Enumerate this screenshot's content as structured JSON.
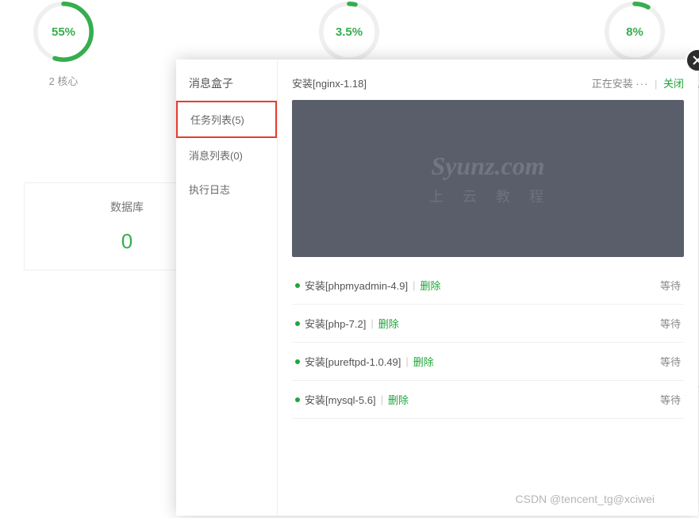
{
  "gauges": [
    {
      "value": "55%",
      "label": "2 核心",
      "dash": "165 300"
    },
    {
      "value": "3.5%",
      "label": "",
      "dash": "10 300"
    },
    {
      "value": "8%",
      "label": "",
      "dash": "24 300"
    }
  ],
  "bg_card": {
    "title": "数据库",
    "value": "0"
  },
  "right_frag1": "G /",
  "right_frag2": "KB",
  "modal": {
    "title": "消息盒子",
    "tabs": {
      "tasks": "任务列表(5)",
      "messages": "消息列表(0)",
      "logs": "执行日志"
    },
    "current_task": {
      "name": "安装[nginx-1.18]",
      "status": "正在安装",
      "ellipsis": "···",
      "close": "关闭"
    },
    "watermark": "Syunz.com",
    "watermark_sub": "上云教程",
    "queue": [
      {
        "label": "安装[phpmyadmin-4.9]",
        "del": "删除",
        "status": "等待"
      },
      {
        "label": "安装[php-7.2]",
        "del": "删除",
        "status": "等待"
      },
      {
        "label": "安装[pureftpd-1.0.49]",
        "del": "删除",
        "status": "等待"
      },
      {
        "label": "安装[mysql-5.6]",
        "del": "删除",
        "status": "等待"
      }
    ],
    "separator": "|"
  },
  "csdn": "CSDN @tencent_tg@xciwei"
}
